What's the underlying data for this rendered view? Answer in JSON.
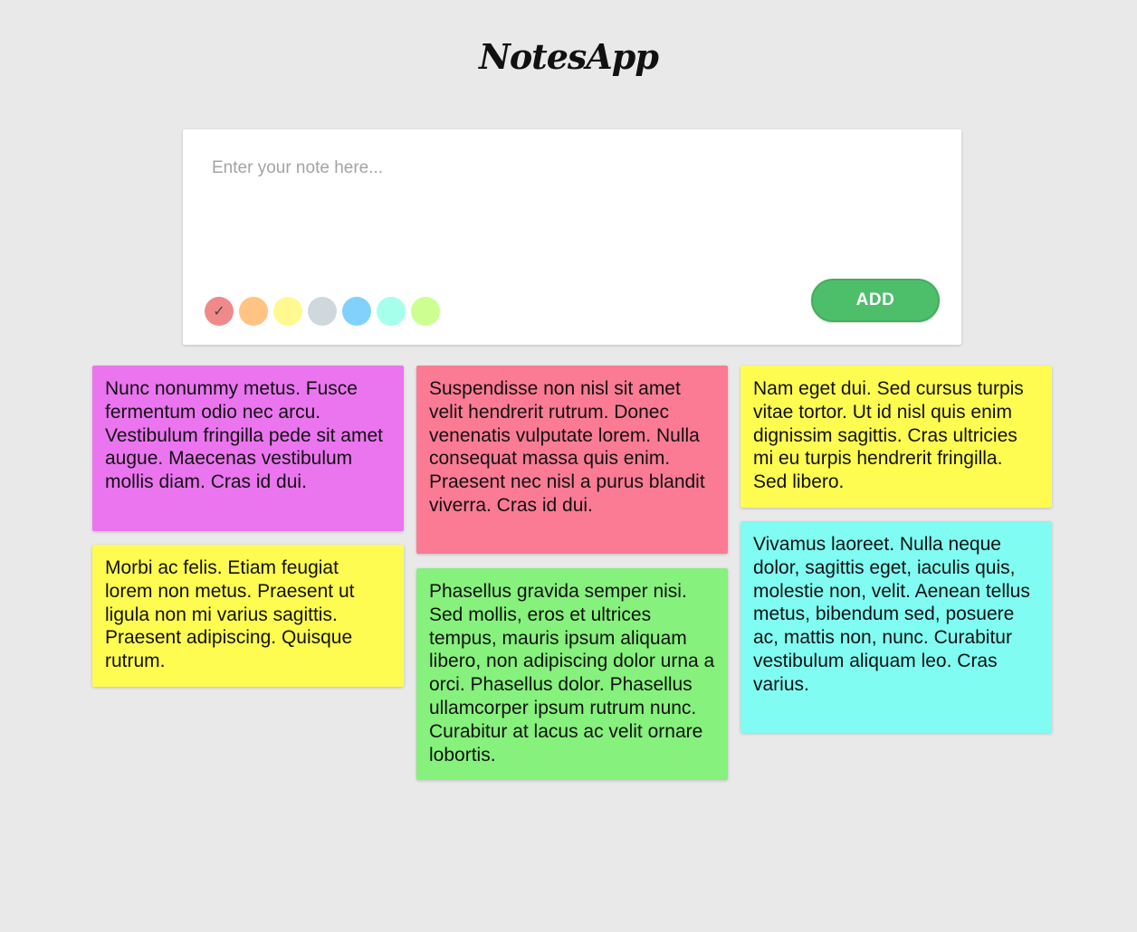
{
  "app": {
    "title": "NotesApp"
  },
  "composer": {
    "placeholder": "Enter your note here...",
    "add_label": "ADD",
    "selected_color_index": 0,
    "check_glyph": "✓",
    "colors": [
      "#f08a8a",
      "#ffc383",
      "#fffa8f",
      "#cfd8dd",
      "#82d1fc",
      "#a6ffeb",
      "#ccff90"
    ]
  },
  "notes": [
    {
      "text": "Nunc nonummy metus. Fusce fermentum odio nec arcu. Vestibulum fringilla pede sit amet augue. Maecenas vestibulum mollis diam. Cras id dui.",
      "color": "#ea75ef"
    },
    {
      "text": "Suspendisse non nisl sit amet velit hendrerit rutrum. Donec venenatis vulputate lorem. Nulla consequat massa quis enim. Praesent nec nisl a purus blandit viverra. Cras id dui.",
      "color": "#fb7b94"
    },
    {
      "text": "Nam eget dui. Sed cursus turpis vitae tortor. Ut id nisl quis enim dignissim sagittis. Cras ultricies mi eu turpis hendrerit fringilla. Sed libero.",
      "color": "#fffc51"
    },
    {
      "text": "Morbi ac felis. Etiam feugiat lorem non metus. Praesent ut ligula non mi varius sagittis. Praesent adipiscing. Quisque rutrum.",
      "color": "#fffc51"
    },
    {
      "text": "Phasellus gravida semper nisi. Sed mollis, eros et ultrices tempus, mauris ipsum aliquam libero, non adipiscing dolor urna a orci. Phasellus dolor. Phasellus ullamcorper ipsum rutrum nunc. Curabitur at lacus ac velit ornare lobortis.",
      "color": "#86f17c"
    },
    {
      "text": "Vivamus laoreet. Nulla neque dolor, sagittis eget, iaculis quis, molestie non, velit. Aenean tellus metus, bibendum sed, posuere ac, mattis non, nunc. Curabitur vestibulum aliquam leo. Cras varius.",
      "color": "#80fcf2"
    }
  ]
}
